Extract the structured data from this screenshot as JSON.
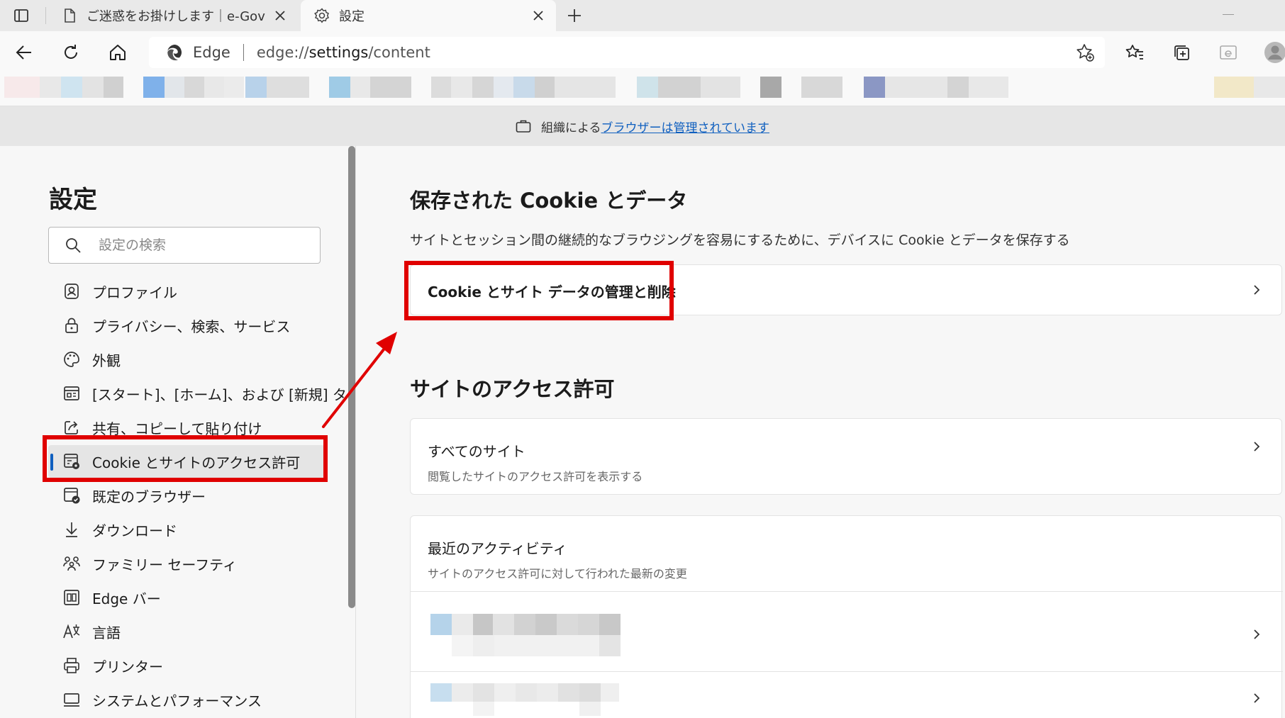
{
  "tabs": [
    {
      "title": "ご迷惑をお掛けします｜e-Gov",
      "active": false
    },
    {
      "title": "設定",
      "active": true
    }
  ],
  "address_bar": {
    "site_label": "Edge",
    "url_prefix": "edge://",
    "url_host": "settings",
    "url_path": "/content"
  },
  "banner": {
    "prefix": "組織による",
    "link": "ブラウザーは管理されています"
  },
  "sidebar": {
    "title": "設定",
    "search_placeholder": "設定の検索",
    "items": [
      {
        "label": "プロファイル",
        "icon": "profile-icon"
      },
      {
        "label": "プライバシー、検索、サービス",
        "icon": "lock-icon"
      },
      {
        "label": "外観",
        "icon": "palette-icon"
      },
      {
        "label": "[スタート]、[ホーム]、および [新規] タブ",
        "icon": "start-home-icon"
      },
      {
        "label": "共有、コピーして貼り付け",
        "icon": "share-icon"
      },
      {
        "label": "Cookie とサイトのアクセス許可",
        "icon": "cookie-permissions-icon",
        "selected": true
      },
      {
        "label": "既定のブラウザー",
        "icon": "default-browser-icon"
      },
      {
        "label": "ダウンロード",
        "icon": "download-icon"
      },
      {
        "label": "ファミリー セーフティ",
        "icon": "family-icon"
      },
      {
        "label": "Edge バー",
        "icon": "edge-bar-icon"
      },
      {
        "label": "言語",
        "icon": "language-icon"
      },
      {
        "label": "プリンター",
        "icon": "printer-icon"
      },
      {
        "label": "システムとパフォーマンス",
        "icon": "system-icon"
      }
    ]
  },
  "main": {
    "cookies_heading": "保存された Cookie とデータ",
    "cookies_description": "サイトとセッション間の継続的なブラウジングを容易にするために、デバイスに Cookie とデータを保存する",
    "manage_cookies_label": "Cookie とサイト データの管理と削除",
    "permissions_heading": "サイトのアクセス許可",
    "all_sites": {
      "title": "すべてのサイト",
      "subtitle": "閲覧したサイトのアクセス許可を表示する"
    },
    "recent_activity": {
      "title": "最近のアクティビティ",
      "subtitle": "サイトのアクセス許可に対して行われた最新の変更"
    }
  },
  "colors": {
    "annotation_red": "#e00000",
    "accent_blue": "#0f5fbf"
  }
}
